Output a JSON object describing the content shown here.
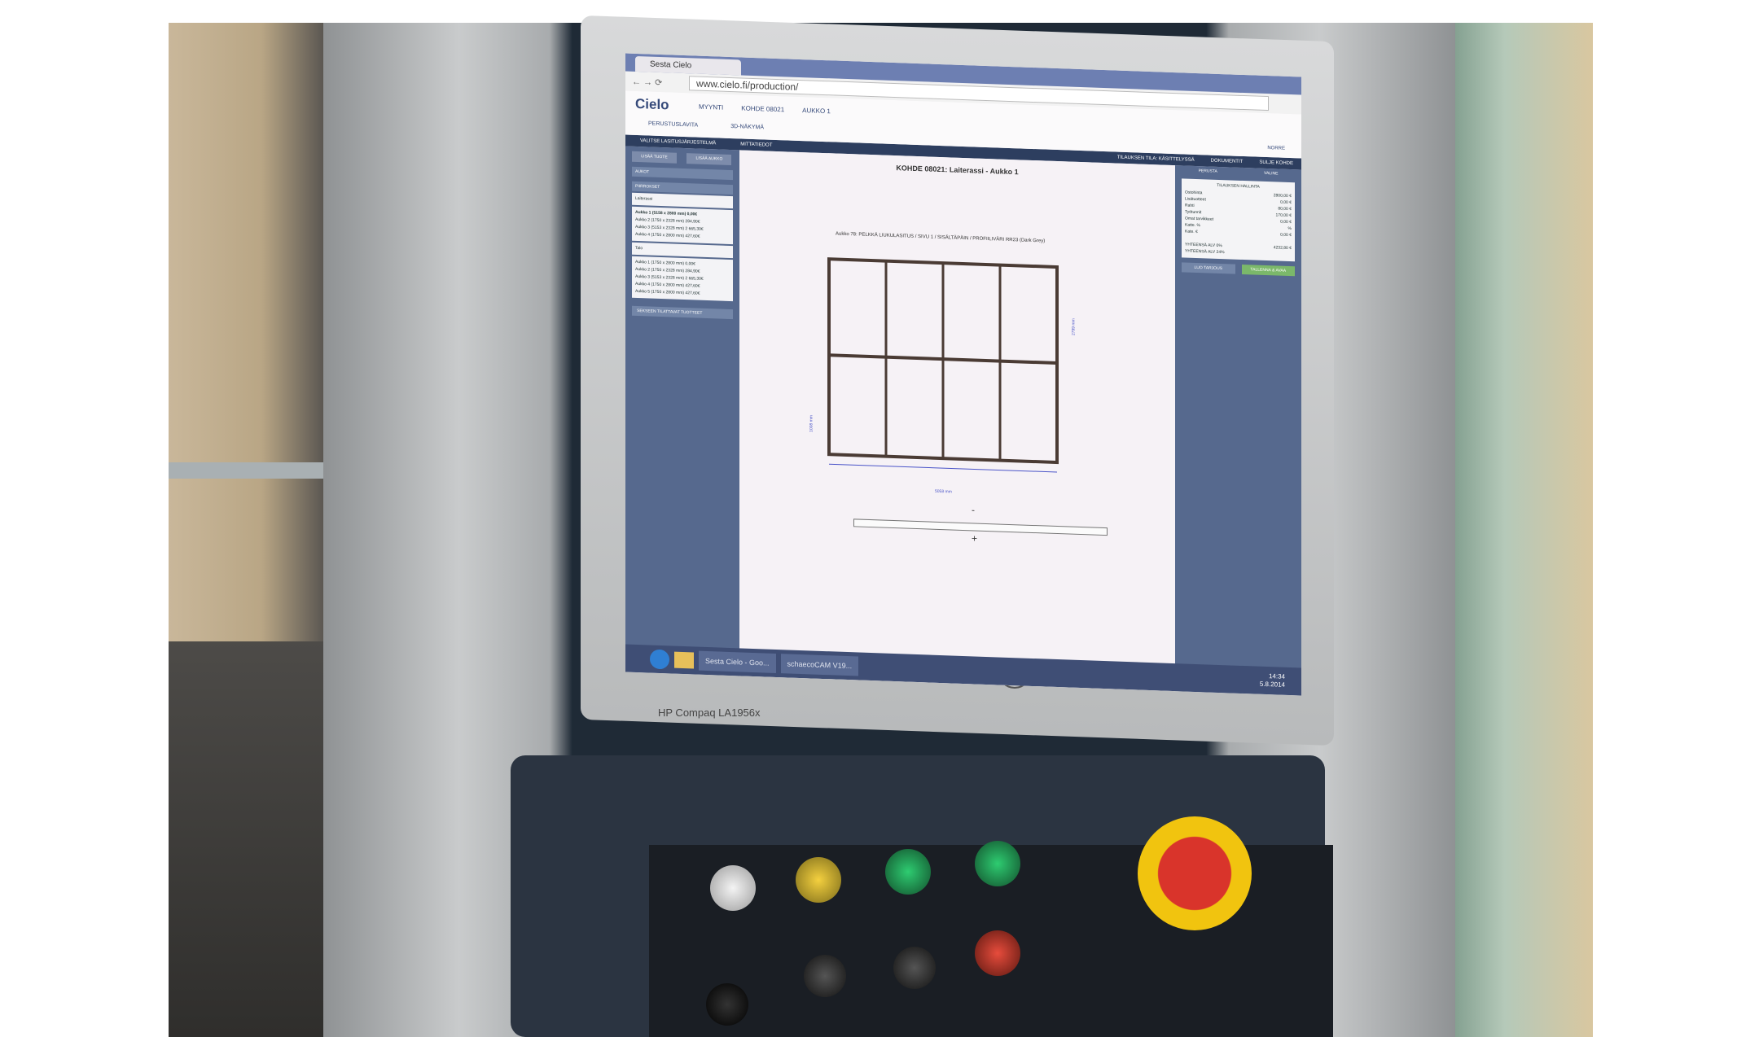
{
  "browser": {
    "tab_title": "Sesta Cielo",
    "url": "www.cielo.fi/production/"
  },
  "app": {
    "logo": "Cielo",
    "breadcrumbs": [
      "MYYNTI",
      "KOHDE 08021",
      "AUKKO 1"
    ],
    "subnav": [
      "PERUSTUSLAVITA",
      "3D-NÄKYMÄ"
    ],
    "user": "NORRE"
  },
  "toolbar": {
    "left": [
      "VALITSE LASITUSJÄRJESTELMÄ",
      "MITTATIEDOT"
    ],
    "right": [
      "TILAUKSEN TILA: KÄSITTELYSSÄ",
      "DOKUMENTIT",
      "SULJE KOHDE"
    ]
  },
  "sidebar": {
    "buttons": [
      "LISÄÄ TUOTE",
      "LISÄÄ AUKKO"
    ],
    "sections": [
      "AUKOT",
      "PIIRROKSET"
    ],
    "group1": "Laiterassi",
    "list1": [
      "Aukko 1 (5158 x 2800 mm) 0,00€",
      "Aukko 2 (1750 x 2328 mm) 284,90€",
      "Aukko 3 (5153 x 2328 mm) 2 665,30€",
      "Aukko 4 (1750 x 2800 mm) 427,60€"
    ],
    "group2": "Talo",
    "list2": [
      "Aukko 1 (1750 x 2800 mm) 0,00€",
      "Aukko 2 (1750 x 2328 mm) 284,90€",
      "Aukko 3 (5153 x 2328 mm) 2 665,30€",
      "Aukko 4 (1750 x 2800 mm) 427,60€",
      "Aukko 5 (1750 x 2800 mm) 427,60€"
    ],
    "footer": "SEKSEEN TILATTAVAT TUOTTEET"
  },
  "main": {
    "title": "KOHDE 08021: Laiterassi - Aukko 1",
    "opening_label": "Aukko 78: PELKKÄ LIUKULASITUS / SIVU 1 / SISÄLTÄPÄIN / PROFIILIVÄRI RR23 (Dark Grey)",
    "width_dim": "5058 mm",
    "height_dim_right": "2799 mm",
    "height_dim_left": "1008 mm",
    "zoom_minus": "-",
    "zoom_plus": "+"
  },
  "right_panel": {
    "tabs": [
      "PERUSTA",
      "VALINE"
    ],
    "header": "TILAUKSEN HALLINTA",
    "rows": [
      {
        "label": "Ostohinta",
        "value": "2800,00 €"
      },
      {
        "label": "Lisätuotteet",
        "value": "0,00 €"
      },
      {
        "label": "Rahti",
        "value": "80,00 €"
      },
      {
        "label": "Työtunnit",
        "value": "170,00 €"
      },
      {
        "label": "Omat tarvikkeet",
        "value": "0,00 €"
      },
      {
        "label": "Katte. %",
        "value": "%"
      },
      {
        "label": "Kate. €",
        "value": "0,00 €"
      }
    ],
    "total_label": "YHTEENSÄ ALV 0%",
    "total_value": "4232,80 €",
    "total_vat_label": "YHTEENSÄ ALV 24%",
    "buttons": [
      "LUO TARJOUS",
      "TALLENNA & AVAA"
    ]
  },
  "taskbar": {
    "items": [
      "Sesta Cielo - Goo...",
      "schaecoCAM V19..."
    ],
    "time": "14:34",
    "date": "5.8.2014"
  },
  "device": {
    "monitor_model": "HP Compaq LA1956x",
    "brand": "hp"
  },
  "colors": {
    "sidebar": "#56698e",
    "toolbar": "#2d3e5f",
    "frame": "#4a3b34",
    "accent_green": "#7bb86a"
  }
}
